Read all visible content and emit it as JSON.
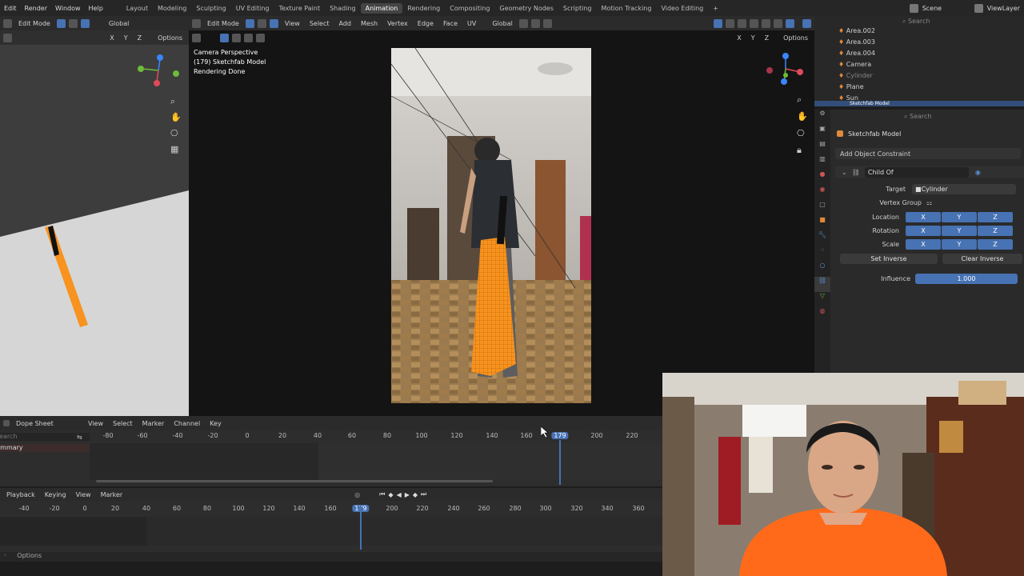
{
  "topmenu": {
    "items": [
      "Edit",
      "Render",
      "Window",
      "Help"
    ],
    "tabs": [
      "Layout",
      "Modeling",
      "Sculpting",
      "UV Editing",
      "Texture Paint",
      "Shading",
      "Animation",
      "Rendering",
      "Compositing",
      "Geometry Nodes",
      "Scripting",
      "Motion Tracking",
      "Video Editing"
    ],
    "active_tab": "Animation",
    "add_tab": "+",
    "scene": "Scene",
    "view_layer": "ViewLayer"
  },
  "left_header": {
    "mode": "Edit Mode",
    "transform": "Global",
    "axes": [
      "X",
      "Y",
      "Z"
    ],
    "options": "Options"
  },
  "main_header": {
    "mode": "Edit Mode",
    "menus": [
      "View",
      "Select",
      "Add",
      "Mesh",
      "Vertex",
      "Edge",
      "Face",
      "UV"
    ],
    "transform": "Global",
    "axes": [
      "X",
      "Y",
      "Z"
    ],
    "options": "Options"
  },
  "viewport_info": {
    "line1": "Camera Perspective",
    "line2": "(179) Sketchfab Model",
    "line3": "Rendering Done"
  },
  "outliner": {
    "search_placeholder": "Search",
    "items": [
      "Area.002",
      "Area.003",
      "Area.004",
      "Camera",
      "Cylinder",
      "Plane",
      "Sun",
      "Sketchfab Model"
    ]
  },
  "properties": {
    "search_placeholder": "Search",
    "object_name": "Sketchfab Model",
    "add_constraint": "Add Object Constraint",
    "constraint_name": "Child Of",
    "target_label": "Target",
    "target_value": "Cylinder",
    "vertex_group_label": "Vertex Group",
    "location_label": "Location",
    "rotation_label": "Rotation",
    "scale_label": "Scale",
    "axes": [
      "X",
      "Y",
      "Z"
    ],
    "set_inverse": "Set Inverse",
    "clear_inverse": "Clear Inverse",
    "influence_label": "Influence",
    "influence_value": "1.000",
    "influence_fraction": 1.0
  },
  "dopesheet": {
    "editor": "Dope Sheet",
    "menus": [
      "View",
      "Select",
      "Marker",
      "Channel",
      "Key"
    ],
    "search_placeholder": "Search",
    "summary": "Summary",
    "ticks": [
      "-80",
      "-60",
      "-40",
      "-20",
      "0",
      "20",
      "40",
      "60",
      "80",
      "100",
      "120",
      "140",
      "160",
      "200",
      "220"
    ],
    "current_frame": "179"
  },
  "timeline": {
    "menus": [
      "Playback",
      "Keying",
      "View",
      "Marker"
    ],
    "ticks": [
      "-40",
      "-20",
      "0",
      "20",
      "40",
      "60",
      "80",
      "100",
      "120",
      "140",
      "160",
      "200",
      "220",
      "240",
      "260",
      "280",
      "300",
      "320",
      "340",
      "360"
    ],
    "current_frame": "179"
  },
  "statusbar": {
    "options": "Options"
  },
  "colors": {
    "accent": "#4772b3",
    "orange_model": "#f7931e",
    "orange_shirt": "#ff6a1a"
  }
}
